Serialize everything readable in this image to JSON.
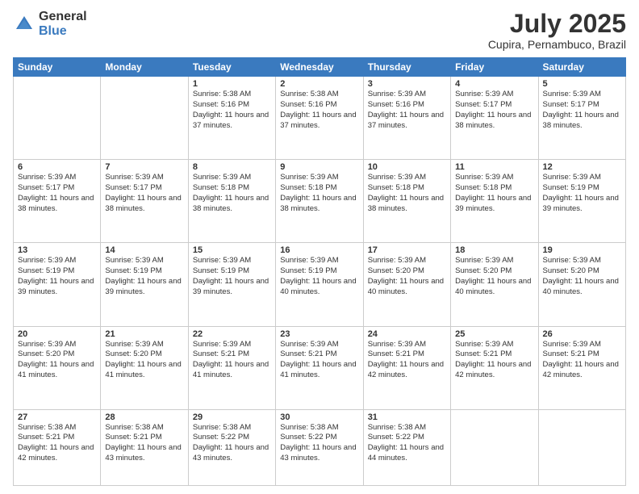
{
  "header": {
    "logo_general": "General",
    "logo_blue": "Blue",
    "month_year": "July 2025",
    "location": "Cupira, Pernambuco, Brazil"
  },
  "days_of_week": [
    "Sunday",
    "Monday",
    "Tuesday",
    "Wednesday",
    "Thursday",
    "Friday",
    "Saturday"
  ],
  "weeks": [
    [
      {
        "day": null
      },
      {
        "day": null
      },
      {
        "day": "1",
        "sunrise": "5:38 AM",
        "sunset": "5:16 PM",
        "daylight": "11 hours and 37 minutes."
      },
      {
        "day": "2",
        "sunrise": "5:38 AM",
        "sunset": "5:16 PM",
        "daylight": "11 hours and 37 minutes."
      },
      {
        "day": "3",
        "sunrise": "5:39 AM",
        "sunset": "5:16 PM",
        "daylight": "11 hours and 37 minutes."
      },
      {
        "day": "4",
        "sunrise": "5:39 AM",
        "sunset": "5:17 PM",
        "daylight": "11 hours and 38 minutes."
      },
      {
        "day": "5",
        "sunrise": "5:39 AM",
        "sunset": "5:17 PM",
        "daylight": "11 hours and 38 minutes."
      }
    ],
    [
      {
        "day": "6",
        "sunrise": "5:39 AM",
        "sunset": "5:17 PM",
        "daylight": "11 hours and 38 minutes."
      },
      {
        "day": "7",
        "sunrise": "5:39 AM",
        "sunset": "5:17 PM",
        "daylight": "11 hours and 38 minutes."
      },
      {
        "day": "8",
        "sunrise": "5:39 AM",
        "sunset": "5:18 PM",
        "daylight": "11 hours and 38 minutes."
      },
      {
        "day": "9",
        "sunrise": "5:39 AM",
        "sunset": "5:18 PM",
        "daylight": "11 hours and 38 minutes."
      },
      {
        "day": "10",
        "sunrise": "5:39 AM",
        "sunset": "5:18 PM",
        "daylight": "11 hours and 38 minutes."
      },
      {
        "day": "11",
        "sunrise": "5:39 AM",
        "sunset": "5:18 PM",
        "daylight": "11 hours and 39 minutes."
      },
      {
        "day": "12",
        "sunrise": "5:39 AM",
        "sunset": "5:19 PM",
        "daylight": "11 hours and 39 minutes."
      }
    ],
    [
      {
        "day": "13",
        "sunrise": "5:39 AM",
        "sunset": "5:19 PM",
        "daylight": "11 hours and 39 minutes."
      },
      {
        "day": "14",
        "sunrise": "5:39 AM",
        "sunset": "5:19 PM",
        "daylight": "11 hours and 39 minutes."
      },
      {
        "day": "15",
        "sunrise": "5:39 AM",
        "sunset": "5:19 PM",
        "daylight": "11 hours and 39 minutes."
      },
      {
        "day": "16",
        "sunrise": "5:39 AM",
        "sunset": "5:19 PM",
        "daylight": "11 hours and 40 minutes."
      },
      {
        "day": "17",
        "sunrise": "5:39 AM",
        "sunset": "5:20 PM",
        "daylight": "11 hours and 40 minutes."
      },
      {
        "day": "18",
        "sunrise": "5:39 AM",
        "sunset": "5:20 PM",
        "daylight": "11 hours and 40 minutes."
      },
      {
        "day": "19",
        "sunrise": "5:39 AM",
        "sunset": "5:20 PM",
        "daylight": "11 hours and 40 minutes."
      }
    ],
    [
      {
        "day": "20",
        "sunrise": "5:39 AM",
        "sunset": "5:20 PM",
        "daylight": "11 hours and 41 minutes."
      },
      {
        "day": "21",
        "sunrise": "5:39 AM",
        "sunset": "5:20 PM",
        "daylight": "11 hours and 41 minutes."
      },
      {
        "day": "22",
        "sunrise": "5:39 AM",
        "sunset": "5:21 PM",
        "daylight": "11 hours and 41 minutes."
      },
      {
        "day": "23",
        "sunrise": "5:39 AM",
        "sunset": "5:21 PM",
        "daylight": "11 hours and 41 minutes."
      },
      {
        "day": "24",
        "sunrise": "5:39 AM",
        "sunset": "5:21 PM",
        "daylight": "11 hours and 42 minutes."
      },
      {
        "day": "25",
        "sunrise": "5:39 AM",
        "sunset": "5:21 PM",
        "daylight": "11 hours and 42 minutes."
      },
      {
        "day": "26",
        "sunrise": "5:39 AM",
        "sunset": "5:21 PM",
        "daylight": "11 hours and 42 minutes."
      }
    ],
    [
      {
        "day": "27",
        "sunrise": "5:38 AM",
        "sunset": "5:21 PM",
        "daylight": "11 hours and 42 minutes."
      },
      {
        "day": "28",
        "sunrise": "5:38 AM",
        "sunset": "5:21 PM",
        "daylight": "11 hours and 43 minutes."
      },
      {
        "day": "29",
        "sunrise": "5:38 AM",
        "sunset": "5:22 PM",
        "daylight": "11 hours and 43 minutes."
      },
      {
        "day": "30",
        "sunrise": "5:38 AM",
        "sunset": "5:22 PM",
        "daylight": "11 hours and 43 minutes."
      },
      {
        "day": "31",
        "sunrise": "5:38 AM",
        "sunset": "5:22 PM",
        "daylight": "11 hours and 44 minutes."
      },
      {
        "day": null
      },
      {
        "day": null
      }
    ]
  ]
}
